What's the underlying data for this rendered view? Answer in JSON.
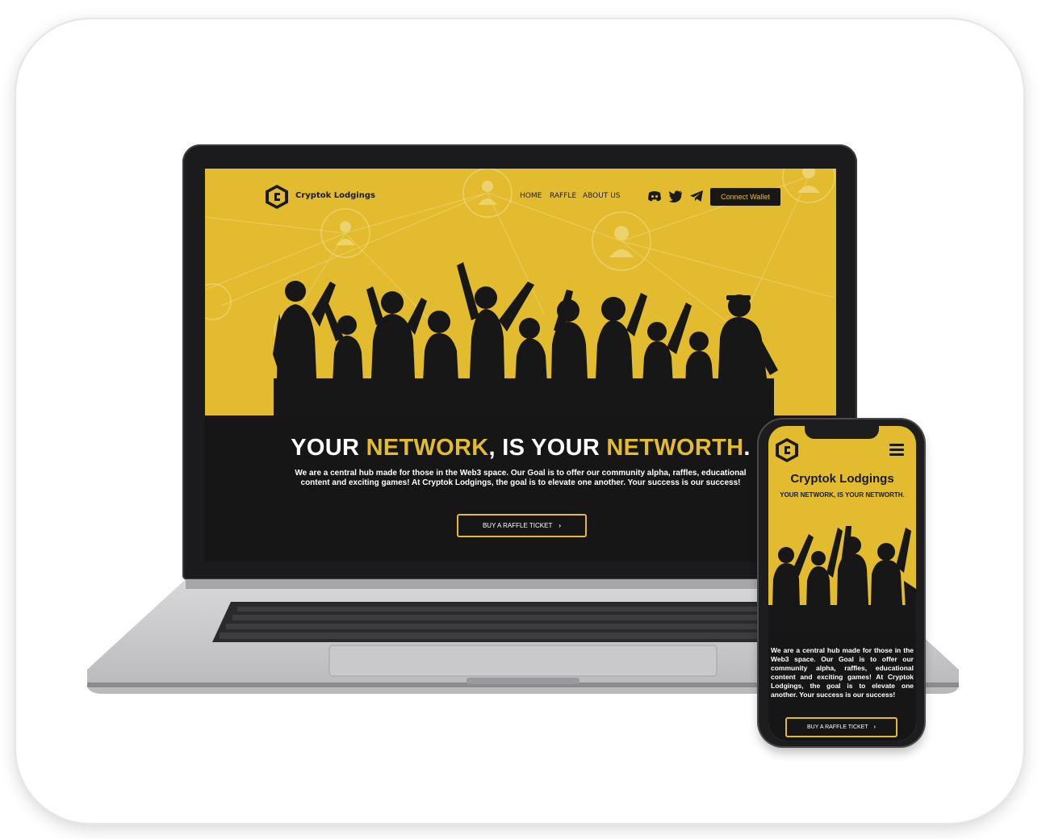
{
  "brand": {
    "name": "Cryptok Lodgings"
  },
  "nav": {
    "links": [
      "HOME",
      "RAFFLE",
      "ABOUT US"
    ],
    "social_icons": [
      "discord-icon",
      "twitter-icon",
      "telegram-icon"
    ],
    "wallet_button": "Connect Wallet"
  },
  "hero": {
    "headline_parts": [
      "YOUR ",
      "NETWORK",
      ", IS YOUR ",
      "NETWORTH",
      "."
    ],
    "description": "We are a central hub made for those in the Web3 space.  Our Goal is to offer our community alpha, raffles, educational content and exciting games! At Cryptok Lodgings, the goal is to elevate one another. Your success is our success!",
    "cta_button": "BUY A RAFFLE TICKET"
  },
  "mobile": {
    "title": "Cryptok Lodgings",
    "tagline": "YOUR NETWORK, IS YOUR NETWORTH.",
    "description": "We are a central hub made for those in the Web3 space.  Our Goal is to offer our community alpha, raffles, educational content and exciting games! At Cryptok Lodgings, the goal is to elevate one another. Your success is our success!",
    "cta_button": "BUY A RAFFLE TICKET",
    "menu_icon": "hamburger-icon"
  },
  "colors": {
    "accent": "#e2bb2e",
    "dark": "#161616",
    "text_light": "#ffffff"
  }
}
